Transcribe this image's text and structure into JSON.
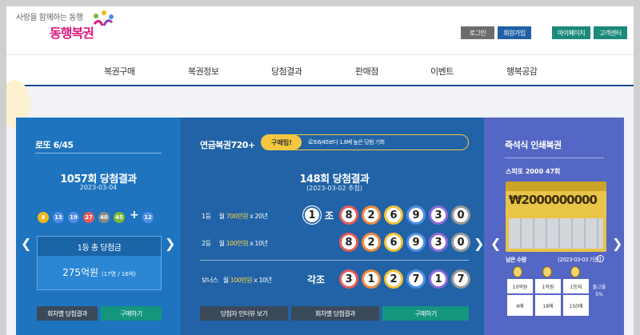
{
  "header": {
    "slogan": "사랑을 함께하는 동행",
    "logo": "동행복권",
    "top_buttons": [
      {
        "label": "로그인",
        "color": "#6d6d6d"
      },
      {
        "label": "회원가입",
        "color": "#1f5fa6"
      },
      {
        "label": "마이페이지",
        "color": "#1b8a7a"
      },
      {
        "label": "고객센터",
        "color": "#1b8a7a"
      }
    ],
    "nav": [
      "복권구매",
      "복권정보",
      "당첨결과",
      "판매점",
      "이벤트",
      "행복공감"
    ]
  },
  "lotto": {
    "title": "로또 6/45",
    "round_title": "1057회 당첨결과",
    "date": "2023-03-04",
    "numbers": [
      {
        "n": "8",
        "color": "#f2b819"
      },
      {
        "n": "13",
        "color": "#4e8ee6"
      },
      {
        "n": "19",
        "color": "#4e8ee6"
      },
      {
        "n": "27",
        "color": "#e25b5b"
      },
      {
        "n": "40",
        "color": "#8a8a8a"
      },
      {
        "n": "45",
        "color": "#7bb83a"
      }
    ],
    "plus": "+",
    "bonus": {
      "n": "12",
      "color": "#4e8ee6"
    },
    "prize_head": "1등 총 당첨금",
    "prize_amount": "275억원",
    "prize_detail": "(17명 / 16억)",
    "btn_round": "회차별 당첨결과",
    "btn_buy": "구매하기"
  },
  "pension": {
    "title": "연금복권720+",
    "buy_tag": "구매팁!",
    "buy_desc": "로또6/45보다 1.6배 높은 당첨 기회",
    "round_title": "148회 당첨결과",
    "date": "(2023-03-02 추첨)",
    "rows": [
      {
        "rank": "1등",
        "pre": "월 ",
        "amount": "700만원",
        "post": " x 20년"
      },
      {
        "rank": "2등",
        "pre": "월 ",
        "amount": "100만원",
        "post": " x 10년"
      },
      {
        "rank": "보너스",
        "pre": "월 ",
        "amount": "100만원",
        "post": " x 10년"
      }
    ],
    "first_group": "1",
    "jo": "조",
    "first_digits": [
      "8",
      "2",
      "6",
      "9",
      "3",
      "0"
    ],
    "second_digits": [
      "8",
      "2",
      "6",
      "9",
      "3",
      "0"
    ],
    "bonus_label": "각조",
    "bonus_digits": [
      "3",
      "1",
      "2",
      "7",
      "1",
      "7"
    ],
    "btn_interview": "당첨자 인터뷰 보기",
    "btn_round": "회차별 당첨결과",
    "btn_buy": "구매하기"
  },
  "speetto": {
    "title": "즉석식 인쇄복권",
    "sub": "스피또 2000 47회",
    "ticket_amount": "₩2000000000",
    "remain_label": "남은 수량",
    "remain_date": "(2023-03-03 기준)",
    "tiers": [
      {
        "label": "10억원",
        "count": "6매"
      },
      {
        "label": "1억원",
        "count": "18매"
      },
      {
        "label": "1등외",
        "count": "150매"
      }
    ],
    "rate_label": "출고율",
    "rate": "5%"
  }
}
